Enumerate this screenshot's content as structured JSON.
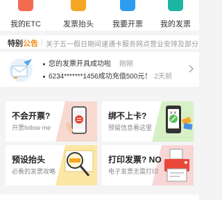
{
  "nav": {
    "items": [
      {
        "label": "我的ETC",
        "icon": "etc-card-icon",
        "color": "#f46b50"
      },
      {
        "label": "发票抬头",
        "icon": "invoice-header-icon",
        "color": "#f5a623"
      },
      {
        "label": "我要开票",
        "icon": "issue-invoice-icon",
        "color": "#2e9cf0"
      },
      {
        "label": "我的发票",
        "icon": "my-invoice-icon",
        "color": "#1cb5a3"
      }
    ]
  },
  "notice": {
    "tag_part1": "特别",
    "tag_part2": "公告",
    "text": "关于五一假日期间速通卡服务网点营业安排及部分业务暂停"
  },
  "messages": [
    {
      "text": "您的发票开具成功啦",
      "time": "刚刚"
    },
    {
      "text": "6234*******1456成功充值500元！",
      "time": "2天前"
    }
  ],
  "tiles": [
    {
      "title": "不会开票?",
      "subtitle": "开票follow me",
      "art": "phone-invoice-icon"
    },
    {
      "title": "绑不上卡?",
      "subtitle": "预留信息看这里",
      "art": "phone-card-icon"
    },
    {
      "title": "预设抬头",
      "subtitle": "必看的发票攻略",
      "art": "magnifier-header-icon"
    },
    {
      "title": "打印发票? NO",
      "subtitle": "电子发票无需打印",
      "art": "printer-icon"
    }
  ],
  "colors": {
    "accent_orange": "#f08c1d",
    "tile_red": "#f7d9d2",
    "tile_green": "#d8f0c6",
    "tile_yellow": "#fbe6a6",
    "tile_pink": "#f8d6d6"
  }
}
